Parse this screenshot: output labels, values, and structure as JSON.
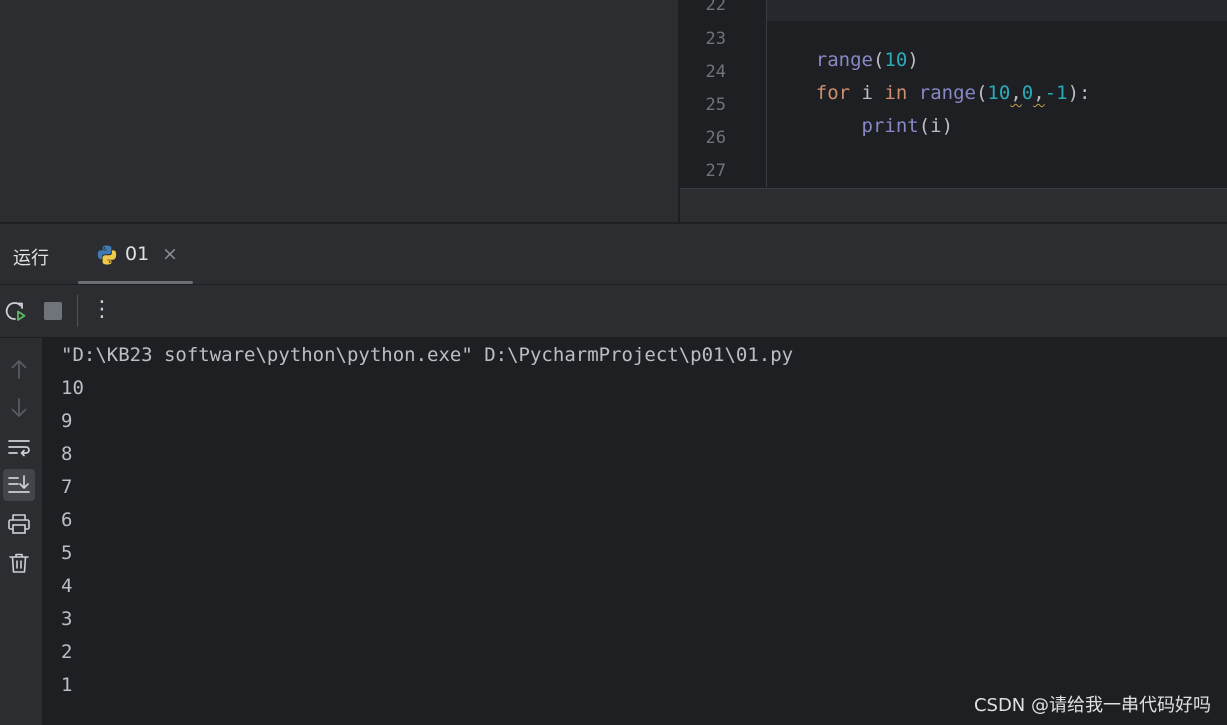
{
  "editor": {
    "line_numbers": [
      "22",
      "23",
      "24",
      "25",
      "26",
      "27"
    ],
    "code": {
      "l23": {
        "fn": "range",
        "p1": "(",
        "num": "10",
        "p2": ")"
      },
      "l24": {
        "kw1": "for",
        "v": " i ",
        "kw2": "in",
        "sp": " ",
        "fn": "range",
        "p1": "(",
        "a": "10",
        "c1": ",",
        "b": "0",
        "c2": ",",
        "c": "-1",
        "p2": "):"
      },
      "l25": {
        "indent": "    ",
        "fn": "print",
        "args": "(i)"
      }
    }
  },
  "run_window": {
    "title": "运行",
    "tab_label": "01",
    "tab_close": "×",
    "toolbar_more": "⋮"
  },
  "console": {
    "command": "\"D:\\KB23 software\\python\\python.exe\" D:\\PycharmProject\\p01\\01.py",
    "output": [
      "10",
      "9",
      "8",
      "7",
      "6",
      "5",
      "4",
      "3",
      "2",
      "1"
    ]
  },
  "watermark": "CSDN @请给我一串代码好吗",
  "colors": {
    "background": "#1e1f22",
    "panel": "#2b2d30",
    "keyword": "#cf8e6d",
    "builtin": "#8888c6",
    "number": "#2aacb8",
    "text": "#bcbec4",
    "run_green": "#5fb865"
  },
  "icons": {
    "rerun": "rerun-icon",
    "stop": "stop-icon",
    "scroll_up": "arrow-up-icon",
    "scroll_down": "arrow-down-icon",
    "soft_wrap": "soft-wrap-icon",
    "scroll_to_end": "scroll-to-end-icon",
    "print": "printer-icon",
    "clear": "trash-icon"
  }
}
